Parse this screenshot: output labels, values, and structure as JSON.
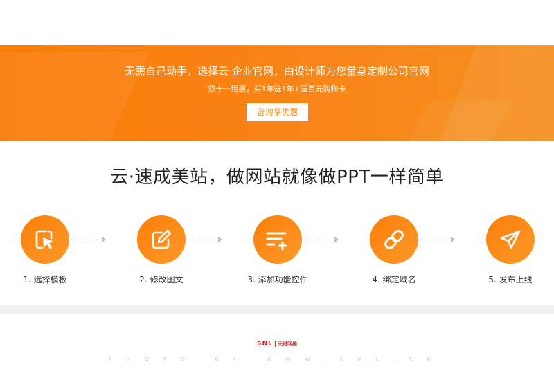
{
  "banner": {
    "title": "无需自己动手，选择云·企业官网，由设计师为您量身定制公司官网",
    "subtitle": "双十一钜惠，买1年送1年+送百元购物卡",
    "button_label": "咨询享优惠"
  },
  "headline": "云·速成美站，做网站就像做PPT一样简单",
  "steps": [
    {
      "label": "1. 选择模板",
      "icon": "cursor-click-icon"
    },
    {
      "label": "2. 修改图文",
      "icon": "edit-icon"
    },
    {
      "label": "3. 添加功能控件",
      "icon": "list-add-icon"
    },
    {
      "label": "4. 绑定域名",
      "icon": "link-icon"
    },
    {
      "label": "5. 发布上线",
      "icon": "send-icon"
    }
  ],
  "footer": {
    "logo_text": "SNL",
    "logo_separator": "|",
    "logo_cn": "天诺网络",
    "watermark": "PHOTO BY WWW.SNL.CN"
  },
  "colors": {
    "accent": "#fb7c07",
    "accent_light": "#fb9a2a",
    "button_text": "#f08519",
    "logo_red": "#d41e24"
  }
}
